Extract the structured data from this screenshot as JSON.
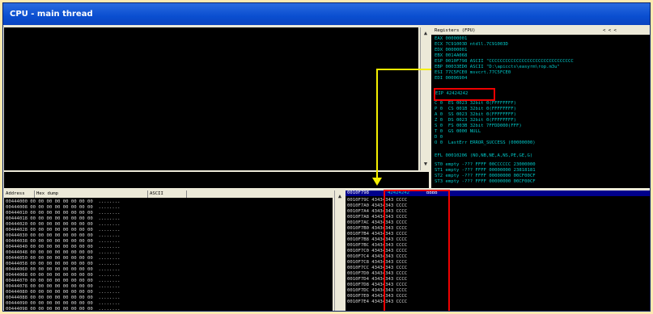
{
  "window": {
    "title": "CPU - main thread"
  },
  "registers": {
    "header": "Registers (FPU)",
    "header_arrows": "<   <   <",
    "lines": [
      "EAX 00000001",
      "ECX 7C91003D ntdll.7C91003D",
      "EDX 00000001",
      "EBX 0014A068",
      "ESP 0010F798 ASCII \"CCCCCCCCCCCCCCCCCCCCCCCCCCCCCCC",
      "EBP 00033ED0 ASCII \"D:\\apiccts\\easyrm\\rop.m3u\"",
      "ESI 77C5FCE0 msvcrt.77C5FCE0",
      "EDI 00006904"
    ],
    "eip": "EIP 42424242",
    "flags": [
      "C 0  ES 0023 32bit 0(FFFFFFFF)",
      "P 0  CS 001B 32bit 0(FFFFFFFF)",
      "A 0  SS 0023 32bit 0(FFFFFFFF)",
      "Z 0  DS 0023 32bit 0(FFFFFFFF)",
      "S 0  FS 003B 32bit 7FFDD000(FFF)",
      "T 0  GS 0000 NULL",
      "D 0",
      "O 0  LastErr ERROR_SUCCESS (00000000)"
    ],
    "efl": "EFL 00010206 (NO,NB,NE,A,NS,PE,GE,G)",
    "fpu": [
      "ST0 empty -??? FFFF 00CCCCCC 23000000",
      "ST1 empty -??? FFFF 00000000 23818181",
      "ST2 empty -??? FFFF 00000000 00CF00CF",
      "ST3 empty -??? FFFF 00000000 00CF00CF"
    ]
  },
  "dump": {
    "headers": {
      "address": "Address",
      "hex": "Hex dump",
      "ascii": "ASCII"
    },
    "rows": [
      "00444000 00 00 00 00 00 00 00 00  ........",
      "00444008 00 00 00 00 00 00 00 00  ........",
      "00444010 00 00 00 00 00 00 00 00  ........",
      "00444018 00 00 00 00 00 00 00 00  ........",
      "00444020 00 00 00 00 00 00 00 00  ........",
      "00444028 00 00 00 00 00 00 00 00  ........",
      "00444030 00 00 00 00 00 00 00 00  ........",
      "00444038 00 00 00 00 00 00 00 00  ........",
      "00444040 00 00 00 00 00 00 00 00  ........",
      "00444048 00 00 00 00 00 00 00 00  ........",
      "00444050 00 00 00 00 00 00 00 00  ........",
      "00444058 00 00 00 00 00 00 00 00  ........",
      "00444060 00 00 00 00 00 00 00 00  ........",
      "00444068 00 00 00 00 00 00 00 00  ........",
      "00444070 00 00 00 00 00 00 00 00  ........",
      "00444078 00 00 00 00 00 00 00 00  ........",
      "00444080 00 00 00 00 00 00 00 00  ........",
      "00444088 00 00 00 00 00 00 00 00  ........",
      "00444090 00 00 00 00 00 00 00 00  ........",
      "00444098 00 00 00 00 00 00 00 00  ........"
    ]
  },
  "stack": {
    "top_address": "0010F798",
    "top_value": "42424242",
    "top_ascii": "BBBB",
    "rows": [
      "0010F79C 43434343 CCCC",
      "0010F7A0 43434343 CCCC",
      "0010F7A4 43434343 CCCC",
      "0010F7A8 43434343 CCCC",
      "0010F7AC 43434343 CCCC",
      "0010F7B0 43434343 CCCC",
      "0010F7B4 43434343 CCCC",
      "0010F7B8 43434343 CCCC",
      "0010F7BC 43434343 CCCC",
      "0010F7C0 43434343 CCCC",
      "0010F7C4 43434343 CCCC",
      "0010F7C8 43434343 CCCC",
      "0010F7CC 43434343 CCCC",
      "0010F7D0 43434343 CCCC",
      "0010F7D4 43434343 CCCC",
      "0010F7D8 43434343 CCCC",
      "0010F7DC 43434343 CCCC",
      "0010F7E0 43434343 CCCC",
      "0010F7E4 43434343 CCCC"
    ]
  },
  "colors": {
    "register_text": "#00c8c8",
    "highlight_red": "#e00000",
    "arrow_yellow": "#f5ef00",
    "selection_blue": "#00008c"
  }
}
